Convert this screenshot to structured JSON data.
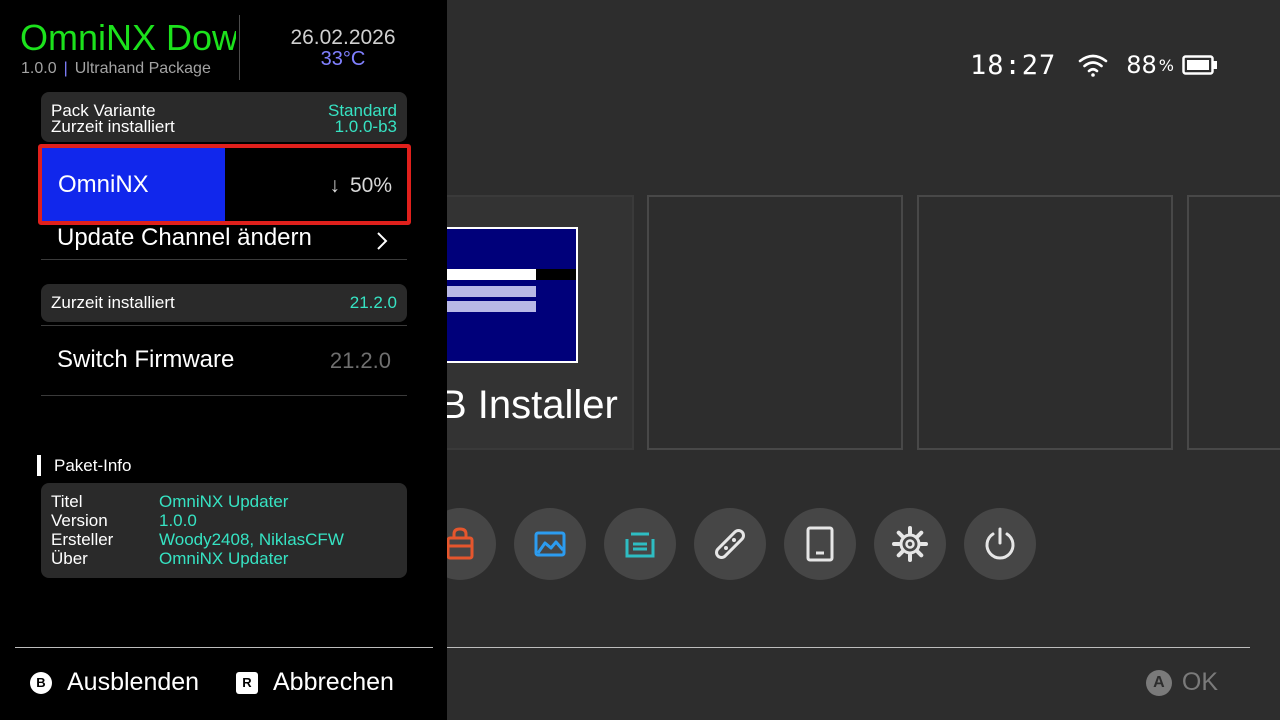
{
  "statusbar": {
    "time": "18:27",
    "battery_percent": "88",
    "battery_unit": "%"
  },
  "home": {
    "tile_title": "B Installer",
    "ok_button_glyph": "A",
    "ok_label": "OK",
    "icons": [
      "shop-icon",
      "album-icon",
      "news-icon",
      "controllers-icon",
      "console-icon",
      "settings-icon",
      "power-icon"
    ],
    "icon_colors": {
      "shop": "#e5562d",
      "album": "#2c9cf0",
      "news": "#2ebdc3",
      "neutral": "#e6e6e6"
    }
  },
  "overlay": {
    "title": "OmniNX Dow",
    "version": "1.0.0",
    "separator": "|",
    "package": "Ultrahand Package",
    "date": "26.02.2026",
    "temperature": "33°C",
    "pack": {
      "variant_label": "Pack Variante",
      "variant_value": "Standard",
      "installed_label": "Zurzeit installiert",
      "installed_value": "1.0.0-b3"
    },
    "download": {
      "label": "OmniNX",
      "arrow": "↓",
      "percent_text": "50%",
      "progress": 0.5
    },
    "channel_label": "Update Channel ändern",
    "firmware": {
      "installed_label": "Zurzeit installiert",
      "installed_value": "21.2.0",
      "label": "Switch Firmware",
      "value": "21.2.0"
    },
    "info": {
      "heading": "Paket-Info",
      "rows": [
        {
          "key": "Titel",
          "value": "OmniNX Updater"
        },
        {
          "key": "Version",
          "value": "1.0.0"
        },
        {
          "key": "Ersteller",
          "value": "Woody2408, NiklasCFW"
        },
        {
          "key": "Über",
          "value": "OmniNX Updater"
        }
      ]
    },
    "hints": {
      "hide_glyph": "B",
      "hide_label": "Ausblenden",
      "cancel_glyph": "R",
      "cancel_label": "Abbrechen"
    },
    "colors": {
      "title": "#1ce21c",
      "accent": "#36e3c3",
      "highlight": "#8080ff",
      "progress": "#1127ec",
      "selection": "#e0201c"
    }
  }
}
